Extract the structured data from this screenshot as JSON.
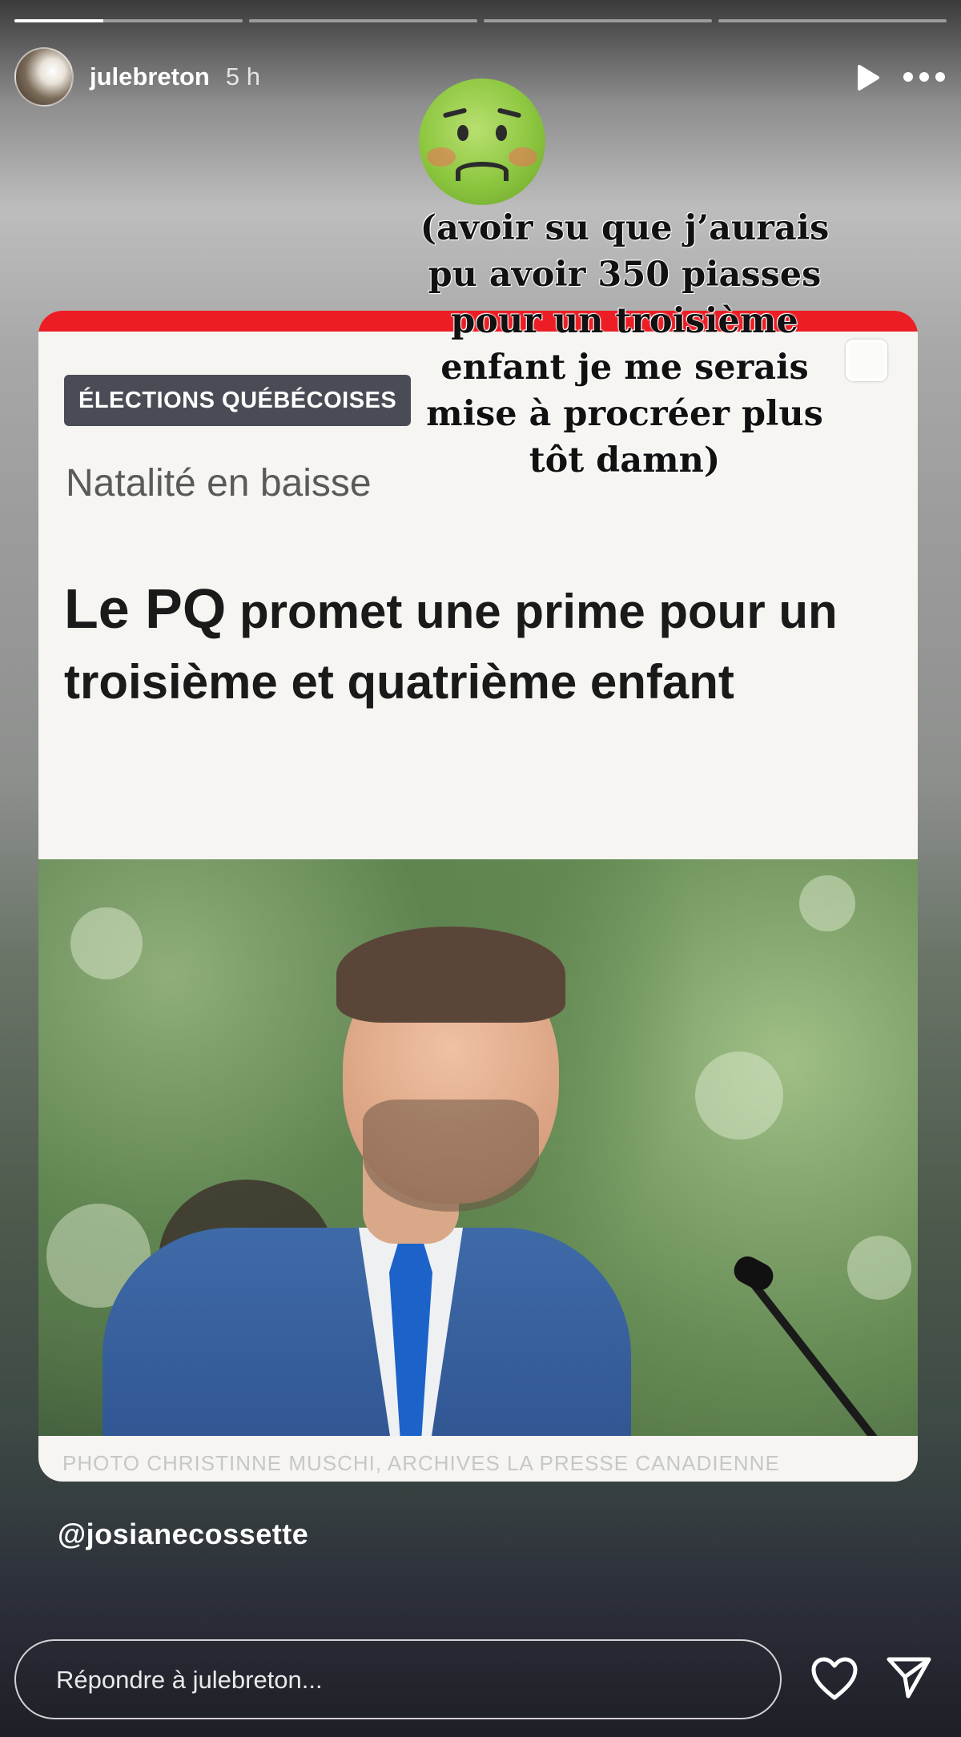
{
  "story": {
    "segments": [
      {
        "progress": 0.39
      },
      {
        "progress": 0
      },
      {
        "progress": 0
      },
      {
        "progress": 0
      }
    ],
    "username": "julebreton",
    "time": "5 h"
  },
  "sticker": {
    "emoji": "nauseated-face",
    "caption_lines": [
      "(avoir su que j’aurais",
      "pu avoir 350 piasses",
      "pour un troisième",
      "enfant je me serais",
      "mise à procréer plus",
      "tôt damn)"
    ]
  },
  "article": {
    "tag": "ÉLECTIONS QUÉBÉCOISES",
    "subhead": "Natalité en baisse",
    "headline_lead": "Le PQ",
    "headline_rest": "promet une prime pour un troisième et quatrième enfant",
    "photo_credit": "PHOTO CHRISTINNE MUSCHI, ARCHIVES LA PRESSE CANADIENNE",
    "accent_color": "#ec1d24"
  },
  "mention": "@josianecossette",
  "reply": {
    "placeholder": "Répondre à julebreton..."
  },
  "icons": {
    "play": "play-icon",
    "more": "more-icon",
    "heart": "heart-icon",
    "send": "send-icon"
  }
}
